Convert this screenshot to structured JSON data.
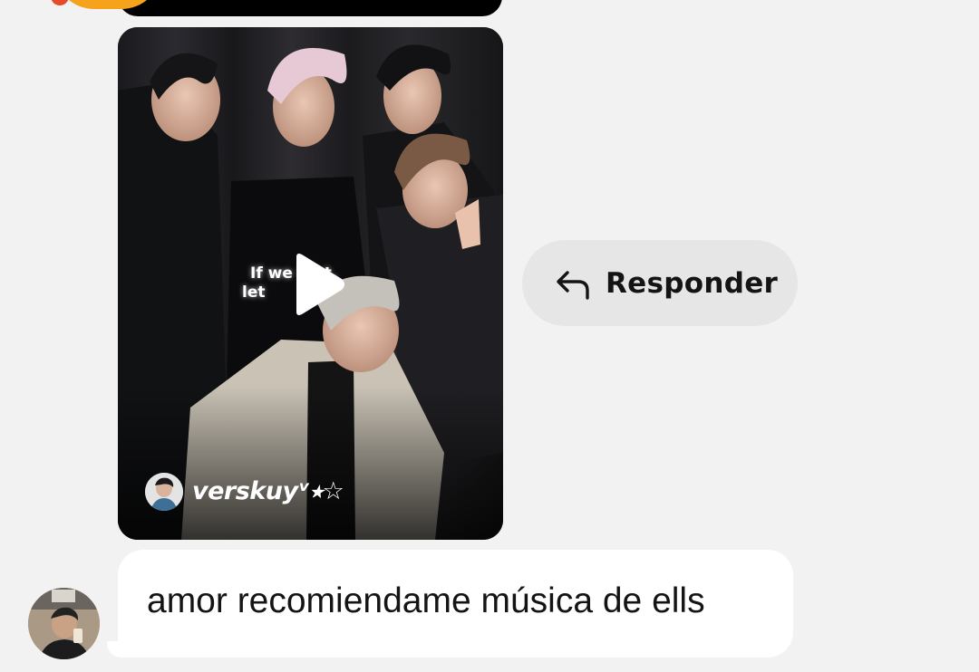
{
  "shared_reel": {
    "caption_line_1": "If we      fast,",
    "caption_line_2": "let",
    "author_name": "verskuyᵛ⭑☆",
    "play_icon": "play-icon"
  },
  "reply_action": {
    "label": "Responder",
    "icon": "reply-arrow-icon"
  },
  "message": {
    "text": "amor recomiendame música de ells"
  },
  "colors": {
    "background": "#f2f2f2",
    "bubble": "#ffffff",
    "reply_pill": "#e6e6e6",
    "text": "#141414"
  }
}
